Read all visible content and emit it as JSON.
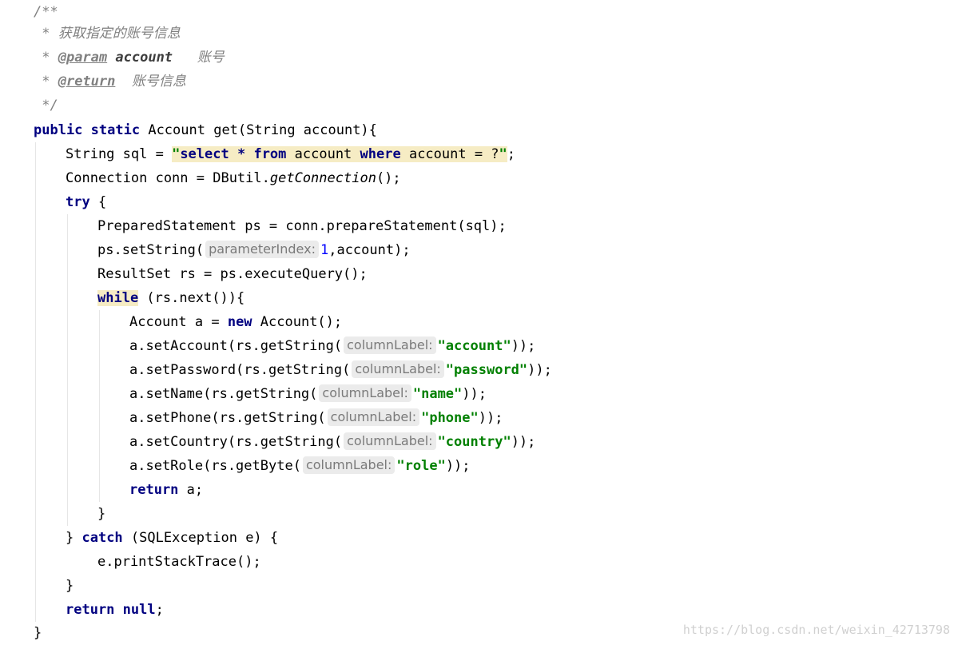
{
  "doc": {
    "open": "/**",
    "line1": " * 获取指定的账号信息",
    "star": " * ",
    "param_tag": "@param",
    "param_name": "account",
    "param_desc": "账号",
    "return_tag": "@return",
    "return_desc": "账号信息",
    "close": " */"
  },
  "code": {
    "kw_public": "public",
    "kw_static": "static",
    "sig_rest": " Account get(String account){",
    "sql_decl": "String sql = ",
    "sql_q1": "\"",
    "sql_select": "select",
    "sql_star": " * ",
    "sql_from": "from",
    "sql_account1": " account ",
    "sql_where": "where",
    "sql_rest": " account = ?",
    "sql_q2": "\"",
    "semi": ";",
    "conn_pre": "Connection conn = DButil.",
    "conn_method": "getConnection",
    "conn_post": "();",
    "kw_try": "try",
    "try_post": " {",
    "prep": "PreparedStatement ps = conn.prepareStatement(sql);",
    "setstr_pre": "ps.setString(",
    "hint_param_index": "parameterIndex:",
    "setstr_num": "1",
    "setstr_post": ",account);",
    "rs_line": "ResultSet rs = ps.executeQuery();",
    "kw_while": "while",
    "while_post": " (rs.next()){",
    "acc_pre": "Account a = ",
    "kw_new": "new",
    "acc_post": " Account();",
    "setters": [
      {
        "pre": "a.setAccount(rs.getString(",
        "hint": "columnLabel:",
        "value": "\"account\"",
        "post": "));"
      },
      {
        "pre": "a.setPassword(rs.getString(",
        "hint": "columnLabel:",
        "value": "\"password\"",
        "post": "));"
      },
      {
        "pre": "a.setName(rs.getString(",
        "hint": "columnLabel:",
        "value": "\"name\"",
        "post": "));"
      },
      {
        "pre": "a.setPhone(rs.getString(",
        "hint": "columnLabel:",
        "value": "\"phone\"",
        "post": "));"
      },
      {
        "pre": "a.setCountry(rs.getString(",
        "hint": "columnLabel:",
        "value": "\"country\"",
        "post": "));"
      },
      {
        "pre": "a.setRole(rs.getByte(",
        "hint": "columnLabel:",
        "value": "\"role\"",
        "post": "));"
      }
    ],
    "kw_return": "return",
    "ret_a": " a;",
    "brace_close": "}",
    "catch_pre": "} ",
    "kw_catch": "catch",
    "catch_post": " (SQLException e) {",
    "print_trace": "e.printStackTrace();",
    "kw_null": "null",
    "space": " "
  },
  "watermark": "https://blog.csdn.net/weixin_42713798"
}
